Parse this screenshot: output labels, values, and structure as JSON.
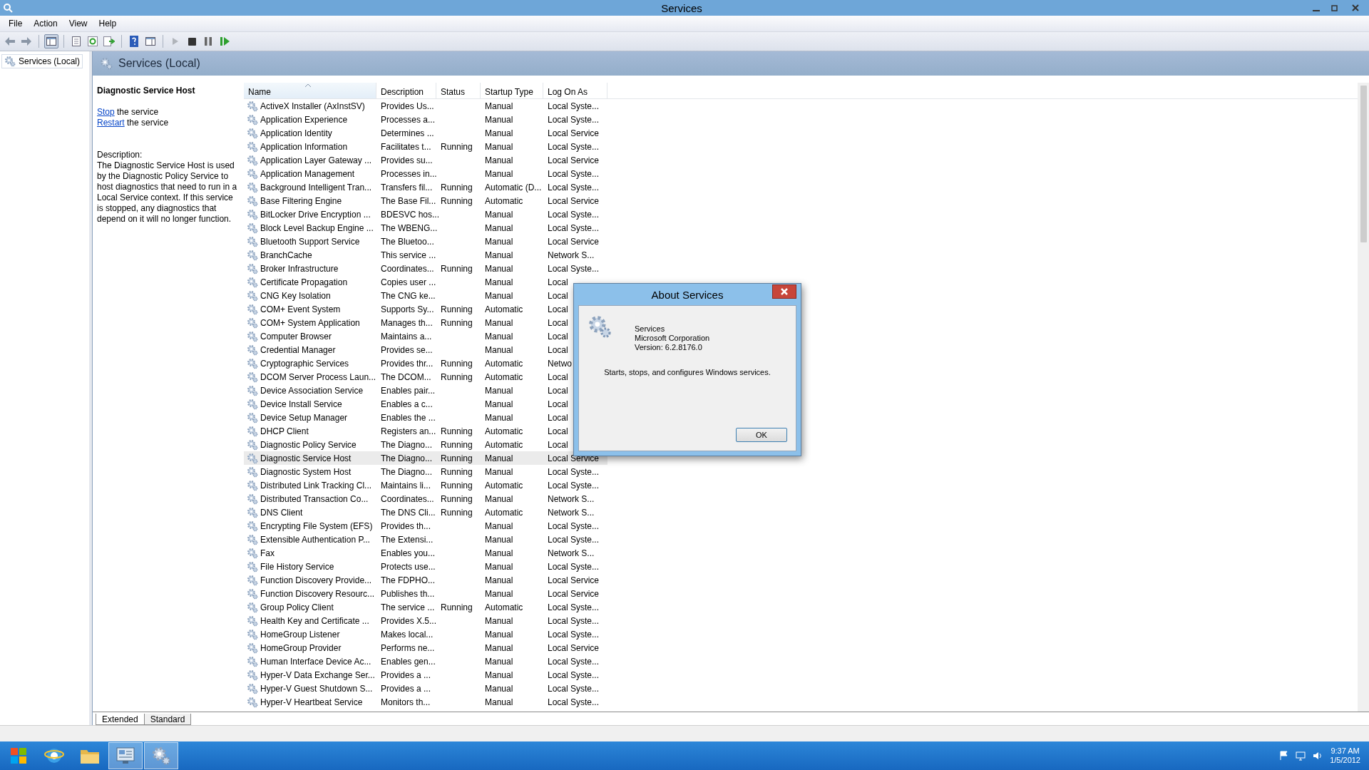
{
  "window": {
    "title": "Services"
  },
  "menu": [
    "File",
    "Action",
    "View",
    "Help"
  ],
  "tree": {
    "items": [
      {
        "label": "Services (Local)"
      }
    ]
  },
  "pane_header": "Services (Local)",
  "detail": {
    "title": "Diagnostic Service Host",
    "actions": [
      {
        "link": "Stop",
        "text": "the service"
      },
      {
        "link": "Restart",
        "text": "the service"
      }
    ],
    "description_label": "Description:",
    "description": "The Diagnostic Service Host is used by the Diagnostic Policy Service to host diagnostics that need to run in a Local Service context.  If this service is stopped, any diagnostics that depend on it will no longer function."
  },
  "table": {
    "columns": [
      "Name",
      "Description",
      "Status",
      "Startup Type",
      "Log On As"
    ],
    "rows": [
      {
        "name": "ActiveX Installer (AxInstSV)",
        "description": "Provides Us...",
        "startup_type": "Manual",
        "log_on_as": "Local Syste...",
        "selected": false
      },
      {
        "name": "Application Experience",
        "description": "Processes a...",
        "startup_type": "Manual",
        "log_on_as": "Local Syste...",
        "selected": false
      },
      {
        "name": "Application Identity",
        "description": "Determines ...",
        "startup_type": "Manual",
        "log_on_as": "Local Service",
        "selected": false
      },
      {
        "name": "Application Information",
        "description": "Facilitates t...",
        "status": "Running",
        "startup_type": "Manual",
        "log_on_as": "Local Syste...",
        "selected": false
      },
      {
        "name": "Application Layer Gateway ...",
        "description": "Provides su...",
        "startup_type": "Manual",
        "log_on_as": "Local Service",
        "selected": false
      },
      {
        "name": "Application Management",
        "description": "Processes in...",
        "startup_type": "Manual",
        "log_on_as": "Local Syste...",
        "selected": false
      },
      {
        "name": "Background Intelligent Tran...",
        "description": "Transfers fil...",
        "status": "Running",
        "startup_type": "Automatic (D...",
        "log_on_as": "Local Syste...",
        "selected": false
      },
      {
        "name": "Base Filtering Engine",
        "description": "The Base Fil...",
        "status": "Running",
        "startup_type": "Automatic",
        "log_on_as": "Local Service",
        "selected": false
      },
      {
        "name": "BitLocker Drive Encryption ...",
        "description": "BDESVC hos...",
        "startup_type": "Manual",
        "log_on_as": "Local Syste...",
        "selected": false
      },
      {
        "name": "Block Level Backup Engine ...",
        "description": "The WBENG...",
        "startup_type": "Manual",
        "log_on_as": "Local Syste...",
        "selected": false
      },
      {
        "name": "Bluetooth Support Service",
        "description": "The Bluetoo...",
        "startup_type": "Manual",
        "log_on_as": "Local Service",
        "selected": false
      },
      {
        "name": "BranchCache",
        "description": "This service ...",
        "startup_type": "Manual",
        "log_on_as": "Network S...",
        "selected": false
      },
      {
        "name": "Broker Infrastructure",
        "description": "Coordinates...",
        "status": "Running",
        "startup_type": "Manual",
        "log_on_as": "Local Syste...",
        "selected": false
      },
      {
        "name": "Certificate Propagation",
        "description": "Copies user ...",
        "startup_type": "Manual",
        "log_on_as": "Local",
        "selected": false
      },
      {
        "name": "CNG Key Isolation",
        "description": "The CNG ke...",
        "startup_type": "Manual",
        "log_on_as": "Local",
        "selected": false
      },
      {
        "name": "COM+ Event System",
        "description": "Supports Sy...",
        "status": "Running",
        "startup_type": "Automatic",
        "log_on_as": "Local",
        "selected": false
      },
      {
        "name": "COM+ System Application",
        "description": "Manages th...",
        "status": "Running",
        "startup_type": "Manual",
        "log_on_as": "Local",
        "selected": false
      },
      {
        "name": "Computer Browser",
        "description": "Maintains a...",
        "startup_type": "Manual",
        "log_on_as": "Local",
        "selected": false
      },
      {
        "name": "Credential Manager",
        "description": "Provides se...",
        "startup_type": "Manual",
        "log_on_as": "Local",
        "selected": false
      },
      {
        "name": "Cryptographic Services",
        "description": "Provides thr...",
        "status": "Running",
        "startup_type": "Automatic",
        "log_on_as": "Netwo",
        "selected": false
      },
      {
        "name": "DCOM Server Process Laun...",
        "description": "The DCOM...",
        "status": "Running",
        "startup_type": "Automatic",
        "log_on_as": "Local",
        "selected": false
      },
      {
        "name": "Device Association Service",
        "description": "Enables pair...",
        "startup_type": "Manual",
        "log_on_as": "Local",
        "selected": false
      },
      {
        "name": "Device Install Service",
        "description": "Enables a c...",
        "startup_type": "Manual",
        "log_on_as": "Local",
        "selected": false
      },
      {
        "name": "Device Setup Manager",
        "description": "Enables the ...",
        "startup_type": "Manual",
        "log_on_as": "Local",
        "selected": false
      },
      {
        "name": "DHCP Client",
        "description": "Registers an...",
        "status": "Running",
        "startup_type": "Automatic",
        "log_on_as": "Local",
        "selected": false
      },
      {
        "name": "Diagnostic Policy Service",
        "description": "The Diagno...",
        "status": "Running",
        "startup_type": "Automatic",
        "log_on_as": "Local",
        "selected": false
      },
      {
        "name": "Diagnostic Service Host",
        "description": "The Diagno...",
        "status": "Running",
        "startup_type": "Manual",
        "log_on_as": "Local Service",
        "selected": true
      },
      {
        "name": "Diagnostic System Host",
        "description": "The Diagno...",
        "status": "Running",
        "startup_type": "Manual",
        "log_on_as": "Local Syste...",
        "selected": false
      },
      {
        "name": "Distributed Link Tracking Cl...",
        "description": "Maintains li...",
        "status": "Running",
        "startup_type": "Automatic",
        "log_on_as": "Local Syste...",
        "selected": false
      },
      {
        "name": "Distributed Transaction Co...",
        "description": "Coordinates...",
        "status": "Running",
        "startup_type": "Manual",
        "log_on_as": "Network S...",
        "selected": false
      },
      {
        "name": "DNS Client",
        "description": "The DNS Cli...",
        "status": "Running",
        "startup_type": "Automatic",
        "log_on_as": "Network S...",
        "selected": false
      },
      {
        "name": "Encrypting File System (EFS)",
        "description": "Provides th...",
        "startup_type": "Manual",
        "log_on_as": "Local Syste...",
        "selected": false
      },
      {
        "name": "Extensible Authentication P...",
        "description": "The Extensi...",
        "startup_type": "Manual",
        "log_on_as": "Local Syste...",
        "selected": false
      },
      {
        "name": "Fax",
        "description": "Enables you...",
        "startup_type": "Manual",
        "log_on_as": "Network S...",
        "selected": false
      },
      {
        "name": "File History Service",
        "description": "Protects use...",
        "startup_type": "Manual",
        "log_on_as": "Local Syste...",
        "selected": false
      },
      {
        "name": "Function Discovery Provide...",
        "description": "The FDPHO...",
        "startup_type": "Manual",
        "log_on_as": "Local Service",
        "selected": false
      },
      {
        "name": "Function Discovery Resourc...",
        "description": "Publishes th...",
        "startup_type": "Manual",
        "log_on_as": "Local Service",
        "selected": false
      },
      {
        "name": "Group Policy Client",
        "description": "The service ...",
        "status": "Running",
        "startup_type": "Automatic",
        "log_on_as": "Local Syste...",
        "selected": false
      },
      {
        "name": "Health Key and Certificate ...",
        "description": "Provides X.5...",
        "startup_type": "Manual",
        "log_on_as": "Local Syste...",
        "selected": false
      },
      {
        "name": "HomeGroup Listener",
        "description": "Makes local...",
        "startup_type": "Manual",
        "log_on_as": "Local Syste...",
        "selected": false
      },
      {
        "name": "HomeGroup Provider",
        "description": "Performs ne...",
        "startup_type": "Manual",
        "log_on_as": "Local Service",
        "selected": false
      },
      {
        "name": "Human Interface Device Ac...",
        "description": "Enables gen...",
        "startup_type": "Manual",
        "log_on_as": "Local Syste...",
        "selected": false
      },
      {
        "name": "Hyper-V Data Exchange Ser...",
        "description": "Provides a ...",
        "startup_type": "Manual",
        "log_on_as": "Local Syste...",
        "selected": false
      },
      {
        "name": "Hyper-V Guest Shutdown S...",
        "description": "Provides a ...",
        "startup_type": "Manual",
        "log_on_as": "Local Syste...",
        "selected": false
      },
      {
        "name": "Hyper-V Heartbeat Service",
        "description": "Monitors th...",
        "startup_type": "Manual",
        "log_on_as": "Local Syste...",
        "selected": false
      }
    ]
  },
  "tabs": [
    {
      "label": "Extended",
      "selected": true
    },
    {
      "label": "Standard",
      "selected": false
    }
  ],
  "dialog": {
    "title": "About Services",
    "product": "Services",
    "company": "Microsoft Corporation",
    "version": "Version: 6.2.8176.0",
    "summary": "Starts, stops, and configures Windows services.",
    "button": "OK"
  },
  "taskbar": {
    "time": "9:37 AM",
    "date": "1/5/2012"
  }
}
